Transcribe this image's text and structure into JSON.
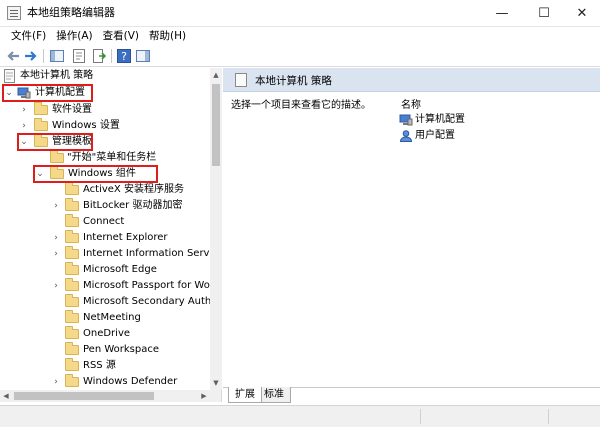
{
  "window": {
    "title": "本地组策略编辑器",
    "min_glyph": "—",
    "max_glyph": "☐",
    "close_glyph": "✕"
  },
  "menu": [
    "文件(F)",
    "操作(A)",
    "查看(V)",
    "帮助(H)"
  ],
  "toolbar": {
    "icons": [
      "back-icon",
      "forward-icon",
      "show-hide-tree-icon",
      "properties-icon",
      "export-list-icon",
      "help-icon",
      "show-hide-action-pane-icon"
    ]
  },
  "tree": {
    "root": "本地计算机 策略",
    "computer_config": "计算机配置",
    "software_settings": "软件设置",
    "windows_settings": "Windows 设置",
    "admin_templates": "管理模板",
    "start_menu": "\"开始\"菜单和任务栏",
    "windows_components": "Windows 组件",
    "components": [
      "ActiveX 安装程序服务",
      "BitLocker 驱动器加密",
      "Connect",
      "Internet Explorer",
      "Internet Information Service",
      "Microsoft Edge",
      "Microsoft Passport for Wor",
      "Microsoft Secondary Auther",
      "NetMeeting",
      "OneDrive",
      "Pen Workspace",
      "RSS 源",
      "Windows Defender"
    ],
    "has_children": [
      false,
      true,
      false,
      true,
      true,
      false,
      true,
      false,
      false,
      false,
      false,
      false,
      true
    ]
  },
  "right": {
    "header": "本地计算机 策略",
    "description": "选择一个项目来查看它的描述。",
    "column_name": "名称",
    "items": [
      "计算机配置",
      "用户配置"
    ]
  },
  "tabs": [
    "扩展",
    "标准"
  ],
  "colors": {
    "highlight": "#e01d1d",
    "header_bg": "#d9e4f0",
    "folder": "#f5d98a"
  }
}
